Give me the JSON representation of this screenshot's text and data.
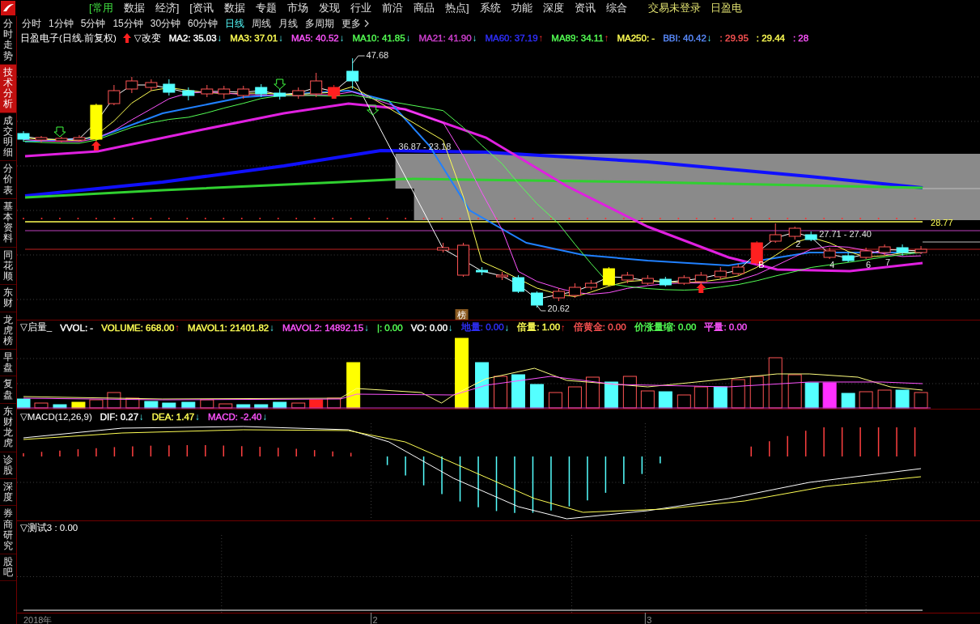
{
  "menu": {
    "items": [
      {
        "label": "[常用",
        "selected": true
      },
      {
        "label": "数据",
        "selected": false
      },
      {
        "label": "经济]",
        "selected": false
      },
      {
        "label": "[资讯",
        "selected": false
      },
      {
        "label": "数据",
        "selected": false
      },
      {
        "label": "专题",
        "selected": false
      },
      {
        "label": "市场",
        "selected": false
      },
      {
        "label": "发现",
        "selected": false
      },
      {
        "label": "行业",
        "selected": false
      },
      {
        "label": "前沿",
        "selected": false
      },
      {
        "label": "商品",
        "selected": false
      },
      {
        "label": "热点]",
        "selected": false
      },
      {
        "label": "系统",
        "selected": false
      },
      {
        "label": "功能",
        "selected": false
      },
      {
        "label": "深度",
        "selected": false
      },
      {
        "label": "资讯",
        "selected": false
      },
      {
        "label": "综合",
        "selected": false
      }
    ],
    "login_status": "交易未登录",
    "stock": "日盈电"
  },
  "periods": [
    {
      "label": "分时",
      "selected": false
    },
    {
      "label": "1分钟",
      "selected": false
    },
    {
      "label": "5分钟",
      "selected": false
    },
    {
      "label": "15分钟",
      "selected": false
    },
    {
      "label": "30分钟",
      "selected": false
    },
    {
      "label": "60分钟",
      "selected": false
    },
    {
      "label": "日线",
      "selected": true
    },
    {
      "label": "周线",
      "selected": false
    },
    {
      "label": "月线",
      "selected": false
    },
    {
      "label": "多周期",
      "selected": false
    },
    {
      "label": "更多",
      "selected": false
    }
  ],
  "sidebar": [
    {
      "label": "分时走势",
      "selected": false
    },
    {
      "label": "技术分析",
      "selected": true
    },
    {
      "label": "成交明细",
      "selected": false
    },
    {
      "label": "分价表",
      "selected": false
    },
    {
      "label": "基本资料",
      "selected": false
    },
    {
      "label": "同花顺",
      "selected": false
    },
    {
      "label": "东财",
      "selected": false
    },
    {
      "label": "龙虎榜",
      "selected": false
    },
    {
      "label": "早盘",
      "selected": false
    },
    {
      "label": "复盘",
      "selected": false
    },
    {
      "label": "东财龙虎",
      "selected": false
    },
    {
      "label": "诊股",
      "selected": false
    },
    {
      "label": "深度",
      "selected": false
    },
    {
      "label": "券商研究",
      "selected": false
    },
    {
      "label": "股吧",
      "selected": false
    }
  ],
  "price_panel": {
    "title": "日盈电子(日线.前复权)",
    "mode": "▽改变",
    "legend": [
      {
        "text": "MA2: 35.03",
        "color": "#ffffff",
        "arrow": "↓",
        "rising": false
      },
      {
        "text": "MA3: 37.01",
        "color": "#ffff54",
        "arrow": "↓",
        "rising": false
      },
      {
        "text": "MA5: 40.52",
        "color": "#ff54ff",
        "arrow": "↓",
        "rising": false
      },
      {
        "text": "MA10: 41.85",
        "color": "#54ff54",
        "arrow": "↓",
        "rising": false
      },
      {
        "text": "MA21: 41.90",
        "color": "#d040d0",
        "arrow": "↓",
        "rising": false
      },
      {
        "text": "MA60: 37.19",
        "color": "#3030ff",
        "arrow": "↑",
        "rising": true
      },
      {
        "text": "MA89: 34.11",
        "color": "#54ff54",
        "arrow": "↑",
        "rising": true
      },
      {
        "text": "MA250: -",
        "color": "#ffff54"
      },
      {
        "text": "BBI: 40.42",
        "color": "#5a8cff",
        "arrow": "↓",
        "rising": false
      },
      {
        "text": ": 29.95",
        "color": "#ff5454"
      },
      {
        "text": ": 29.44",
        "color": "#ffff54"
      },
      {
        "text": ": 28",
        "color": "#ff54ff"
      }
    ],
    "annotations": [
      "47.68",
      "36.87 - 23.18",
      "20.62",
      "B",
      "2",
      "27.71 - 27.40",
      "4",
      "6",
      "7",
      "28.77"
    ],
    "badge": "榜"
  },
  "volume_panel": {
    "title": "▽启量_",
    "legend": [
      {
        "text": "VVOL: -",
        "color": "#ffffff"
      },
      {
        "text": "VOLUME: 668.00",
        "color": "#ffff54",
        "arrow": "↑",
        "rising": true
      },
      {
        "text": "MAVOL1: 21401.82",
        "color": "#ffff54",
        "arrow": "↓",
        "rising": false
      },
      {
        "text": "MAVOL2: 14892.15",
        "color": "#ff54ff",
        "arrow": "↓",
        "rising": false
      },
      {
        "text": "|: 0.00",
        "color": "#54ff54"
      },
      {
        "text": "VO: 0.00",
        "color": "#ffffff",
        "arrow": "↓",
        "rising": false
      },
      {
        "text": "地量: 0.00",
        "color": "#3030ff",
        "arrow": "↓",
        "rising": false
      },
      {
        "text": "倍量: 1.00",
        "color": "#ffff54",
        "arrow": "↑",
        "rising": true
      },
      {
        "text": "倍黄金: 0.00",
        "color": "#ff5454"
      },
      {
        "text": "价涨量缩: 0.00",
        "color": "#54ff54"
      },
      {
        "text": "平量: 0.00",
        "color": "#ff54ff"
      }
    ]
  },
  "macd_panel": {
    "title": "▽MACD(12,26,9)",
    "legend": [
      {
        "text": "DIF: 0.27",
        "color": "#ffffff",
        "arrow": "↓",
        "rising": false
      },
      {
        "text": "DEA: 1.47",
        "color": "#ffff54",
        "arrow": "↓",
        "rising": false
      },
      {
        "text": "MACD: -2.40",
        "color": "#ff54ff",
        "arrow": "↓",
        "rising": false
      }
    ]
  },
  "test_panel": {
    "title": "▽测试3 : 0.00"
  },
  "x_axis": [
    "2018年",
    "2",
    "3"
  ]
}
